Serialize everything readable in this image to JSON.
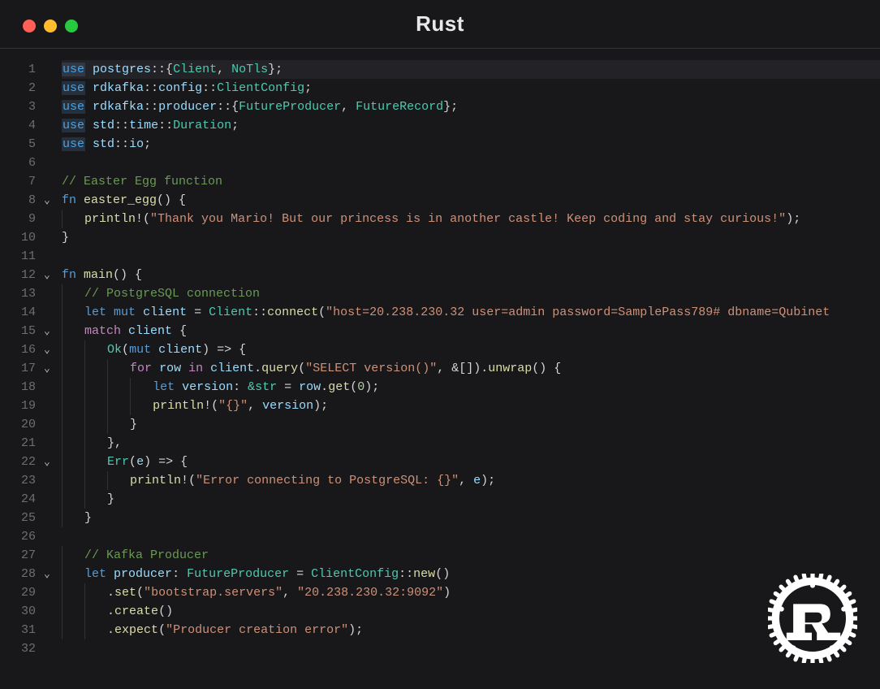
{
  "window": {
    "title": "Rust"
  },
  "traffic_lights": {
    "red": "#ff5f56",
    "yellow": "#ffbd2e",
    "green": "#27c93f"
  },
  "logo": {
    "name": "rust-logo"
  },
  "editor": {
    "language": "rust",
    "current_line": 1,
    "lines": [
      {
        "num": 1,
        "fold": "",
        "tokens": [
          [
            "kw-use",
            "use"
          ],
          [
            "punc",
            " "
          ],
          [
            "ident",
            "postgres"
          ],
          [
            "punc",
            "::{"
          ],
          [
            "type",
            "Client"
          ],
          [
            "punc",
            ", "
          ],
          [
            "type",
            "NoTls"
          ],
          [
            "punc",
            "};"
          ]
        ]
      },
      {
        "num": 2,
        "fold": "",
        "tokens": [
          [
            "kw-use",
            "use"
          ],
          [
            "punc",
            " "
          ],
          [
            "ident",
            "rdkafka"
          ],
          [
            "punc",
            "::"
          ],
          [
            "ident",
            "config"
          ],
          [
            "punc",
            "::"
          ],
          [
            "type",
            "ClientConfig"
          ],
          [
            "punc",
            ";"
          ]
        ]
      },
      {
        "num": 3,
        "fold": "",
        "tokens": [
          [
            "kw-use",
            "use"
          ],
          [
            "punc",
            " "
          ],
          [
            "ident",
            "rdkafka"
          ],
          [
            "punc",
            "::"
          ],
          [
            "ident",
            "producer"
          ],
          [
            "punc",
            "::{"
          ],
          [
            "type",
            "FutureProducer"
          ],
          [
            "punc",
            ", "
          ],
          [
            "type",
            "FutureRecord"
          ],
          [
            "punc",
            "};"
          ]
        ]
      },
      {
        "num": 4,
        "fold": "",
        "tokens": [
          [
            "kw-use",
            "use"
          ],
          [
            "punc",
            " "
          ],
          [
            "ident",
            "std"
          ],
          [
            "punc",
            "::"
          ],
          [
            "ident",
            "time"
          ],
          [
            "punc",
            "::"
          ],
          [
            "type",
            "Duration"
          ],
          [
            "punc",
            ";"
          ]
        ]
      },
      {
        "num": 5,
        "fold": "",
        "tokens": [
          [
            "kw-use",
            "use"
          ],
          [
            "punc",
            " "
          ],
          [
            "ident",
            "std"
          ],
          [
            "punc",
            "::"
          ],
          [
            "ident",
            "io"
          ],
          [
            "punc",
            ";"
          ]
        ]
      },
      {
        "num": 6,
        "fold": "",
        "tokens": []
      },
      {
        "num": 7,
        "fold": "",
        "tokens": [
          [
            "cmt",
            "// Easter Egg function"
          ]
        ]
      },
      {
        "num": 8,
        "fold": "chev",
        "tokens": [
          [
            "kw2",
            "fn"
          ],
          [
            "punc",
            " "
          ],
          [
            "fnname",
            "easter_egg"
          ],
          [
            "punc",
            "() {"
          ]
        ]
      },
      {
        "num": 9,
        "fold": "",
        "indent": 1,
        "tokens": [
          [
            "mac",
            "println!"
          ],
          [
            "punc",
            "("
          ],
          [
            "str",
            "\"Thank you Mario! But our princess is in another castle! Keep coding and stay curious!\""
          ],
          [
            "punc",
            ");"
          ]
        ]
      },
      {
        "num": 10,
        "fold": "",
        "tokens": [
          [
            "punc",
            "}"
          ]
        ]
      },
      {
        "num": 11,
        "fold": "",
        "tokens": []
      },
      {
        "num": 12,
        "fold": "chev",
        "tokens": [
          [
            "kw2",
            "fn"
          ],
          [
            "punc",
            " "
          ],
          [
            "fnname",
            "main"
          ],
          [
            "punc",
            "() {"
          ]
        ]
      },
      {
        "num": 13,
        "fold": "",
        "indent": 1,
        "tokens": [
          [
            "cmt",
            "// PostgreSQL connection"
          ]
        ]
      },
      {
        "num": 14,
        "fold": "",
        "indent": 1,
        "tokens": [
          [
            "kw2",
            "let"
          ],
          [
            "punc",
            " "
          ],
          [
            "kw2",
            "mut"
          ],
          [
            "punc",
            " "
          ],
          [
            "ident",
            "client"
          ],
          [
            "punc",
            " = "
          ],
          [
            "type",
            "Client"
          ],
          [
            "punc",
            "::"
          ],
          [
            "call",
            "connect"
          ],
          [
            "punc",
            "("
          ],
          [
            "str",
            "\"host=20.238.230.32 user=admin password=SamplePass789# dbname=Qubinet"
          ]
        ]
      },
      {
        "num": 15,
        "fold": "chev",
        "indent": 1,
        "tokens": [
          [
            "kw",
            "match"
          ],
          [
            "punc",
            " "
          ],
          [
            "ident",
            "client"
          ],
          [
            "punc",
            " {"
          ]
        ]
      },
      {
        "num": 16,
        "fold": "chev",
        "indent": 2,
        "tokens": [
          [
            "type",
            "Ok"
          ],
          [
            "punc",
            "("
          ],
          [
            "kw2",
            "mut"
          ],
          [
            "punc",
            " "
          ],
          [
            "ident",
            "client"
          ],
          [
            "punc",
            ") "
          ],
          [
            "op",
            "=>"
          ],
          [
            "punc",
            " {"
          ]
        ]
      },
      {
        "num": 17,
        "fold": "chev",
        "indent": 3,
        "tokens": [
          [
            "kw",
            "for"
          ],
          [
            "punc",
            " "
          ],
          [
            "ident",
            "row"
          ],
          [
            "punc",
            " "
          ],
          [
            "kw",
            "in"
          ],
          [
            "punc",
            " "
          ],
          [
            "ident",
            "client"
          ],
          [
            "punc",
            "."
          ],
          [
            "call",
            "query"
          ],
          [
            "punc",
            "("
          ],
          [
            "str",
            "\"SELECT version()\""
          ],
          [
            "punc",
            ", &[])."
          ],
          [
            "call",
            "unwrap"
          ],
          [
            "punc",
            "() {"
          ]
        ]
      },
      {
        "num": 18,
        "fold": "",
        "indent": 4,
        "tokens": [
          [
            "kw2",
            "let"
          ],
          [
            "punc",
            " "
          ],
          [
            "ident",
            "version"
          ],
          [
            "punc",
            ": "
          ],
          [
            "type",
            "&str"
          ],
          [
            "punc",
            " = "
          ],
          [
            "ident",
            "row"
          ],
          [
            "punc",
            "."
          ],
          [
            "call",
            "get"
          ],
          [
            "punc",
            "("
          ],
          [
            "num",
            "0"
          ],
          [
            "punc",
            ");"
          ]
        ]
      },
      {
        "num": 19,
        "fold": "",
        "indent": 4,
        "tokens": [
          [
            "mac",
            "println!"
          ],
          [
            "punc",
            "("
          ],
          [
            "str",
            "\"{}\""
          ],
          [
            "punc",
            ", "
          ],
          [
            "ident",
            "version"
          ],
          [
            "punc",
            ");"
          ]
        ]
      },
      {
        "num": 20,
        "fold": "",
        "indent": 3,
        "tokens": [
          [
            "punc",
            "}"
          ]
        ]
      },
      {
        "num": 21,
        "fold": "",
        "indent": 2,
        "tokens": [
          [
            "punc",
            "},"
          ]
        ]
      },
      {
        "num": 22,
        "fold": "chev",
        "indent": 2,
        "tokens": [
          [
            "type",
            "Err"
          ],
          [
            "punc",
            "("
          ],
          [
            "ident",
            "e"
          ],
          [
            "punc",
            ") "
          ],
          [
            "op",
            "=>"
          ],
          [
            "punc",
            " {"
          ]
        ]
      },
      {
        "num": 23,
        "fold": "",
        "indent": 3,
        "tokens": [
          [
            "mac",
            "println!"
          ],
          [
            "punc",
            "("
          ],
          [
            "str",
            "\"Error connecting to PostgreSQL: {}\""
          ],
          [
            "punc",
            ", "
          ],
          [
            "ident",
            "e"
          ],
          [
            "punc",
            ");"
          ]
        ]
      },
      {
        "num": 24,
        "fold": "",
        "indent": 2,
        "tokens": [
          [
            "punc",
            "}"
          ]
        ]
      },
      {
        "num": 25,
        "fold": "",
        "indent": 1,
        "tokens": [
          [
            "punc",
            "}"
          ]
        ]
      },
      {
        "num": 26,
        "fold": "",
        "tokens": []
      },
      {
        "num": 27,
        "fold": "",
        "indent": 1,
        "tokens": [
          [
            "cmt",
            "// Kafka Producer"
          ]
        ]
      },
      {
        "num": 28,
        "fold": "chev",
        "indent": 1,
        "tokens": [
          [
            "kw2",
            "let"
          ],
          [
            "punc",
            " "
          ],
          [
            "ident",
            "producer"
          ],
          [
            "punc",
            ": "
          ],
          [
            "type",
            "FutureProducer"
          ],
          [
            "punc",
            " = "
          ],
          [
            "type",
            "ClientConfig"
          ],
          [
            "punc",
            "::"
          ],
          [
            "call",
            "new"
          ],
          [
            "punc",
            "()"
          ]
        ]
      },
      {
        "num": 29,
        "fold": "",
        "indent": 2,
        "tokens": [
          [
            "punc",
            "."
          ],
          [
            "call",
            "set"
          ],
          [
            "punc",
            "("
          ],
          [
            "str",
            "\"bootstrap.servers\""
          ],
          [
            "punc",
            ", "
          ],
          [
            "str",
            "\"20.238.230.32:9092\""
          ],
          [
            "punc",
            ")"
          ]
        ]
      },
      {
        "num": 30,
        "fold": "",
        "indent": 2,
        "tokens": [
          [
            "punc",
            "."
          ],
          [
            "call",
            "create"
          ],
          [
            "punc",
            "()"
          ]
        ]
      },
      {
        "num": 31,
        "fold": "",
        "indent": 2,
        "tokens": [
          [
            "punc",
            "."
          ],
          [
            "call",
            "expect"
          ],
          [
            "punc",
            "("
          ],
          [
            "str",
            "\"Producer creation error\""
          ],
          [
            "punc",
            ");"
          ]
        ]
      },
      {
        "num": 32,
        "fold": "",
        "tokens": []
      }
    ]
  }
}
